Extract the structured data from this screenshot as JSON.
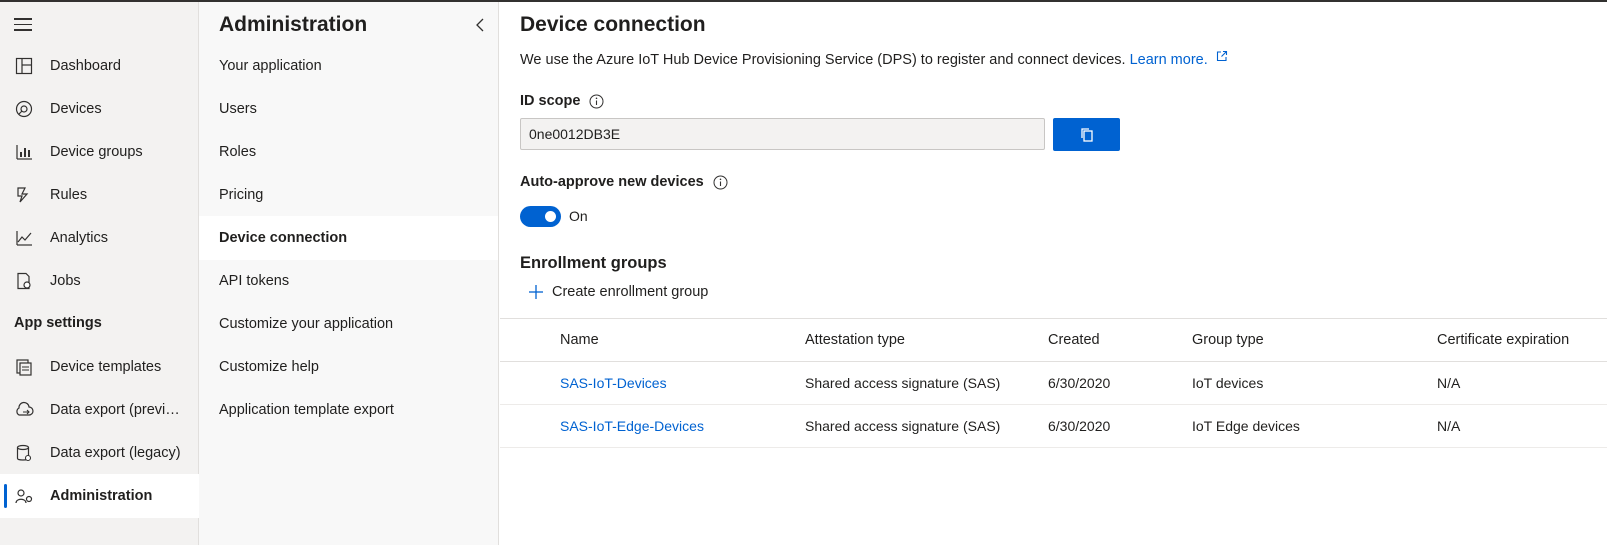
{
  "nav": {
    "items": [
      {
        "label": "Dashboard",
        "icon": "dashboard-icon"
      },
      {
        "label": "Devices",
        "icon": "devices-icon"
      },
      {
        "label": "Device groups",
        "icon": "device-groups-icon"
      },
      {
        "label": "Rules",
        "icon": "rules-icon"
      },
      {
        "label": "Analytics",
        "icon": "analytics-icon"
      },
      {
        "label": "Jobs",
        "icon": "jobs-icon"
      }
    ],
    "section_label": "App settings",
    "settings_items": [
      {
        "label": "Device templates",
        "icon": "device-templates-icon"
      },
      {
        "label": "Data export (previe...",
        "icon": "data-export-icon"
      },
      {
        "label": "Data export (legacy)",
        "icon": "data-export-legacy-icon"
      },
      {
        "label": "Administration",
        "icon": "administration-icon",
        "active": true
      }
    ]
  },
  "admin": {
    "title": "Administration",
    "items": [
      {
        "label": "Your application"
      },
      {
        "label": "Users"
      },
      {
        "label": "Roles"
      },
      {
        "label": "Pricing"
      },
      {
        "label": "Device connection",
        "active": true
      },
      {
        "label": "API tokens"
      },
      {
        "label": "Customize your application"
      },
      {
        "label": "Customize help"
      },
      {
        "label": "Application template export"
      }
    ]
  },
  "main": {
    "title": "Device connection",
    "description": "We use the Azure IoT Hub Device Provisioning Service (DPS) to register and connect devices.",
    "learn_more": "Learn more.",
    "id_scope_label": "ID scope",
    "id_scope_value": "0ne0012DB3E",
    "auto_approve_label": "Auto-approve new devices",
    "auto_approve_state": "On",
    "enrollment_title": "Enrollment groups",
    "create_label": "Create enrollment group",
    "table": {
      "headers": [
        "Name",
        "Attestation type",
        "Created",
        "Group type",
        "Certificate expiration"
      ],
      "rows": [
        [
          "SAS-IoT-Devices",
          "Shared access signature (SAS)",
          "6/30/2020",
          "IoT devices",
          "N/A"
        ],
        [
          "SAS-IoT-Edge-Devices",
          "Shared access signature (SAS)",
          "6/30/2020",
          "IoT Edge devices",
          "N/A"
        ]
      ]
    }
  },
  "colors": {
    "accent": "#0062d1",
    "nav_bg": "#f3f2f1",
    "admin_bg": "#f8f8f8"
  }
}
